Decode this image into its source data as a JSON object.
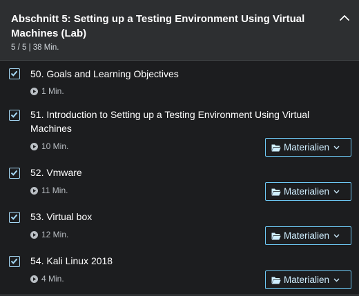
{
  "section": {
    "title": "Abschnitt 5: Setting up a Testing Environment Using Virtual Machines (Lab)",
    "meta": "5 / 5 | 38 Min.",
    "collapse_icon": "chevron-up-icon"
  },
  "colors": {
    "accent": "#a5d8f5",
    "background": "#1c1d1f",
    "header_background": "#2d2f31"
  },
  "lectures": [
    {
      "title": "50. Goals and Learning Objectives",
      "duration": "1 Min.",
      "completed": true,
      "resources_label": ""
    },
    {
      "title": "51. Introduction to Setting up a Testing Environment Using Virtual Machines",
      "duration": "10 Min.",
      "completed": true,
      "resources_label": "Materialien"
    },
    {
      "title": "52. Vmware",
      "duration": "11 Min.",
      "completed": true,
      "resources_label": "Materialien"
    },
    {
      "title": "53. Virtual box",
      "duration": "12 Min.",
      "completed": true,
      "resources_label": "Materialien"
    },
    {
      "title": "54. Kali Linux 2018",
      "duration": "4 Min.",
      "completed": true,
      "resources_label": "Materialien"
    }
  ]
}
